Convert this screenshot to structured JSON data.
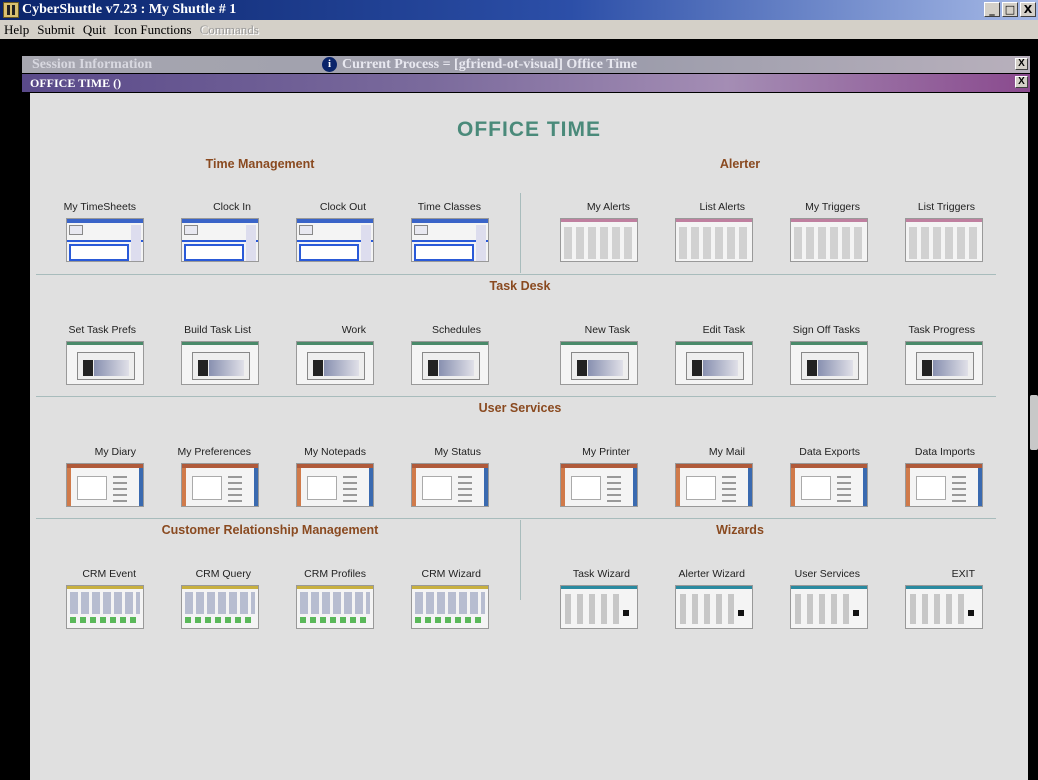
{
  "window": {
    "title": "CyberShuttle v7.23 : My Shuttle # 1",
    "buttons": {
      "minimize": "_",
      "maximize": "□",
      "close": "X"
    }
  },
  "menubar": {
    "items": [
      {
        "label": "Help",
        "enabled": true
      },
      {
        "label": "Submit",
        "enabled": true
      },
      {
        "label": "Quit",
        "enabled": true
      },
      {
        "label": "Icon Functions",
        "enabled": true
      },
      {
        "label": "Commands",
        "enabled": false
      }
    ]
  },
  "session": {
    "label": "Session Information",
    "current_process": "Current Process = [gfriend-ot-visual] Office Time",
    "close": "X"
  },
  "office_bar": {
    "label": "OFFICE TIME  ()",
    "close": "X"
  },
  "main": {
    "title": "OFFICE  TIME",
    "sections": {
      "time_management": "Time Management",
      "alerter": "Alerter",
      "task_desk": "Task Desk",
      "user_services": "User Services",
      "crm": "Customer Relationship Management",
      "wizards": "Wizards"
    },
    "tiles": {
      "time_management": [
        "My TimeSheets",
        "Clock In",
        "Clock Out",
        "Time Classes"
      ],
      "alerter": [
        "My Alerts",
        "List Alerts",
        "My Triggers",
        "List Triggers"
      ],
      "task_desk": [
        "Set Task Prefs",
        "Build Task List",
        "Work",
        "Schedules",
        "New Task",
        "Edit Task",
        "Sign Off Tasks",
        "Task Progress"
      ],
      "user_services": [
        "My Diary",
        "My Preferences",
        "My Notepads",
        "My Status",
        "My Printer",
        "My Mail",
        "Data Exports",
        "Data Imports"
      ],
      "crm": [
        "CRM Event",
        "CRM Query",
        "CRM Profiles",
        "CRM Wizard"
      ],
      "wizards": [
        "Task Wizard",
        "Alerter Wizard",
        "User Services",
        "EXIT"
      ]
    }
  },
  "colors": {
    "title_gradient_start": "#0a246a",
    "main_title": "#4a8a7a",
    "section_title": "#8a4a20",
    "panel_bg": "#e0e0e0"
  }
}
